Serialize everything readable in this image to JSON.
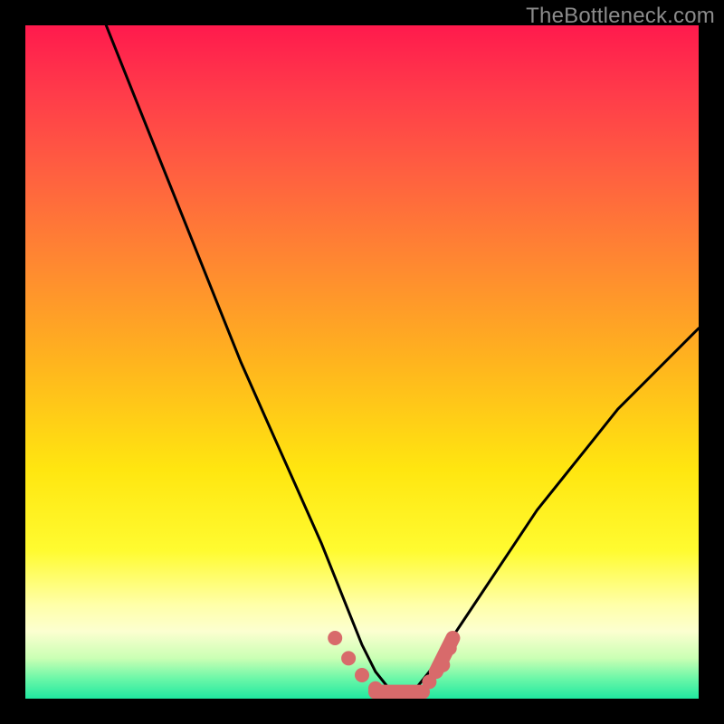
{
  "watermark": "TheBottleneck.com",
  "colors": {
    "background": "#000000",
    "curve": "#000000",
    "marker": "#d86a6b",
    "gradient_top": "#ff1a4d",
    "gradient_bottom": "#20e8a0"
  },
  "chart_data": {
    "type": "line",
    "title": "",
    "xlabel": "",
    "ylabel": "",
    "xlim": [
      0,
      100
    ],
    "ylim": [
      0,
      100
    ],
    "series": [
      {
        "name": "bottleneck-curve",
        "x": [
          12,
          16,
          20,
          24,
          28,
          32,
          36,
          40,
          44,
          48,
          50,
          52,
          54,
          56,
          58,
          60,
          64,
          68,
          72,
          76,
          80,
          84,
          88,
          92,
          96,
          100
        ],
        "y": [
          100,
          90,
          80,
          70,
          60,
          50,
          41,
          32,
          23,
          13,
          8,
          4,
          1.5,
          1,
          1.5,
          4,
          10,
          16,
          22,
          28,
          33,
          38,
          43,
          47,
          51,
          55
        ]
      }
    ],
    "markers": {
      "name": "bottom-markers",
      "points": [
        {
          "x": 46,
          "y": 9
        },
        {
          "x": 48,
          "y": 6
        },
        {
          "x": 50,
          "y": 3.5
        },
        {
          "x": 52,
          "y": 1.5
        },
        {
          "x": 60,
          "y": 2.5
        },
        {
          "x": 62,
          "y": 5
        },
        {
          "x": 63,
          "y": 7.5
        }
      ],
      "capsule_bottom": {
        "x1": 52,
        "x2": 59,
        "y": 1
      },
      "capsule_right": {
        "x1": 61,
        "x2": 63.5,
        "y1": 4,
        "y2": 9
      }
    }
  }
}
